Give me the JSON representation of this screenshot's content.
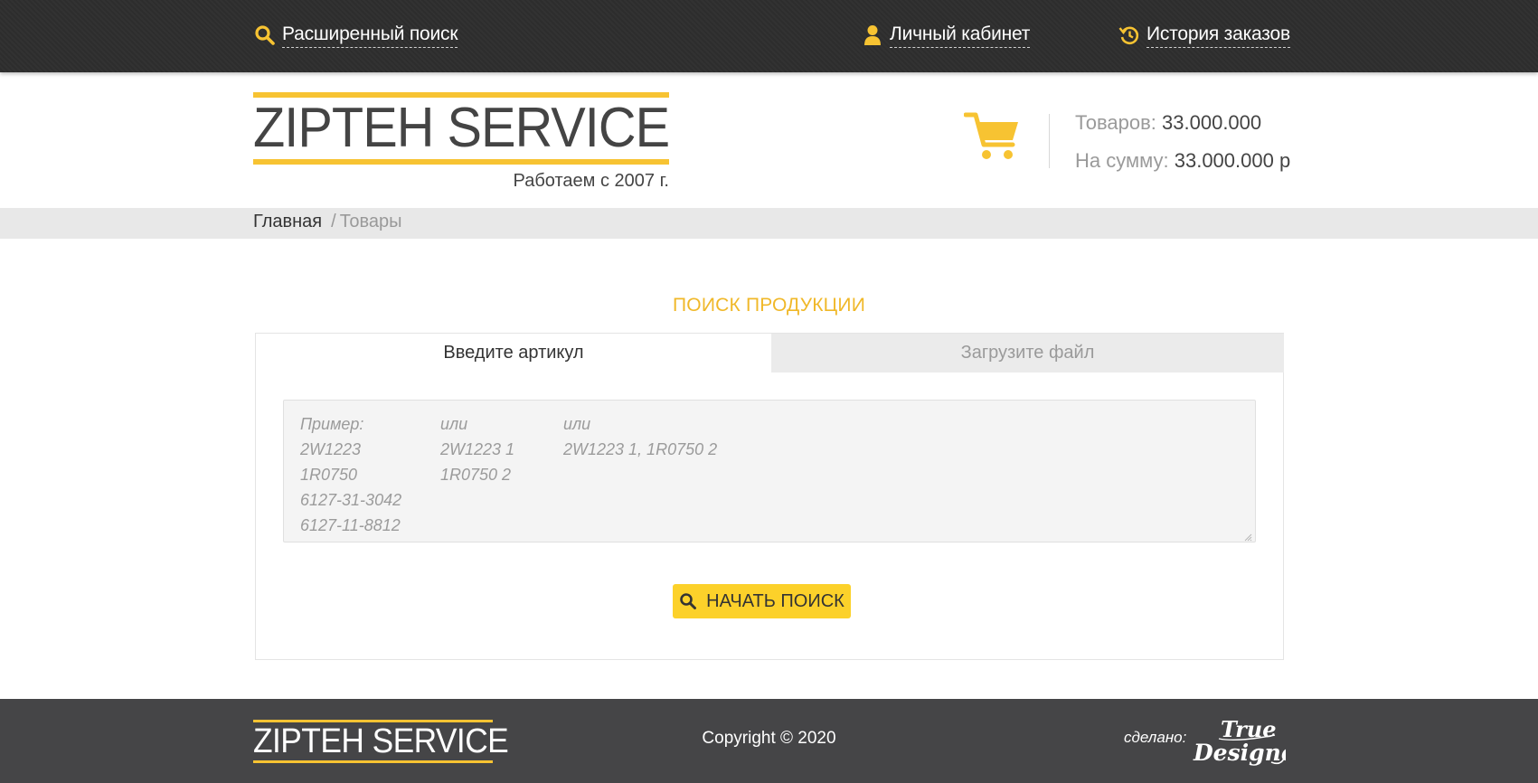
{
  "topbar": {
    "search_label": "Расширенный поиск",
    "account_label": "Личный кабинет",
    "history_label": "История заказов"
  },
  "header": {
    "logo_text": "ZIPTEH SERVICE",
    "tagline": "Работаем с 2007 г.",
    "cart": {
      "count_label": "Товаров:",
      "count_value": "33.000.000",
      "sum_label": "На сумму:",
      "sum_value": "33.000.000 р"
    }
  },
  "breadcrumb": {
    "home": "Главная",
    "separator": "/",
    "current": "Товары"
  },
  "search": {
    "title": "ПОИСК ПРОДУКЦИИ",
    "tabs": [
      {
        "label": "Введите артикул",
        "active": true
      },
      {
        "label": "Загрузите файл",
        "active": false
      }
    ],
    "placeholder": {
      "col1": [
        "Пример:",
        "2W1223",
        "1R0750",
        "6127-31-3042",
        "6127-11-8812"
      ],
      "col2": [
        "или",
        "2W1223 1",
        "1R0750 2"
      ],
      "col3": [
        "или",
        "2W1223 1, 1R0750 2"
      ]
    },
    "button_label": "НАЧАТЬ ПОИСК"
  },
  "footer": {
    "logo_text": "ZIPTEH SERVICE",
    "copyright": "Copyright © 2020",
    "made_by": "сделано:"
  },
  "colors": {
    "accent": "#f7c332",
    "button": "#fcd12a",
    "topbar": "#2e2e2e",
    "footer": "#454547"
  },
  "icons": [
    "search-icon",
    "user-icon",
    "history-icon",
    "cart-icon"
  ]
}
